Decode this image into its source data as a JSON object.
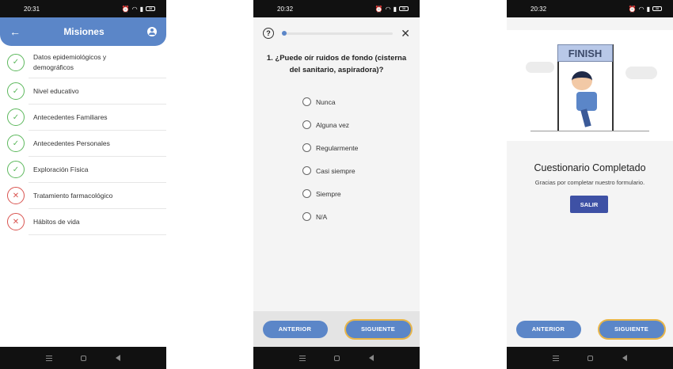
{
  "screen1": {
    "time": "20:31",
    "battery": "38",
    "title": "Misiones",
    "missions": [
      {
        "label": "Datos epidemiológicos y demográficos",
        "status": "ok"
      },
      {
        "label": "Nivel educativo",
        "status": "ok"
      },
      {
        "label": "Antecedentes Familiares",
        "status": "ok"
      },
      {
        "label": "Antecedentes Personales",
        "status": "ok"
      },
      {
        "label": "Exploración Física",
        "status": "ok"
      },
      {
        "label": "Tratamiento farmacológico",
        "status": "bad"
      },
      {
        "label": "Hábitos de vida",
        "status": "bad"
      }
    ]
  },
  "screen2": {
    "time": "20:32",
    "battery": "38",
    "question": "1. ¿Puede oír ruidos de fondo (cisterna del sanitario, aspiradora)?",
    "options": [
      "Nunca",
      "Alguna vez",
      "Regularmente",
      "Casi siempre",
      "Siempre",
      "N/A"
    ],
    "prev_label": "ANTERIOR",
    "next_label": "SIGUIENTE"
  },
  "screen3": {
    "time": "20:32",
    "battery": "38",
    "banner_text": "FINISH",
    "title": "Cuestionario Completado",
    "subtitle": "Gracias por completar nuestro formulario.",
    "exit_label": "SALIR",
    "prev_label": "ANTERIOR",
    "next_label": "SIGUIENTE"
  },
  "colors": {
    "primary": "#5b86c8",
    "success": "#5cb85c",
    "error": "#d9534f",
    "exit": "#3e51a5",
    "highlight": "#e8b64a"
  }
}
